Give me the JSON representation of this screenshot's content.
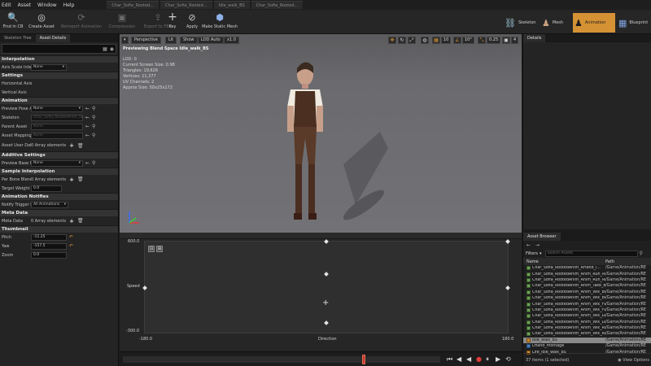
{
  "menubar": {
    "menus": [
      "Edit",
      "Asset",
      "Window",
      "Help"
    ],
    "tabs": [
      "Char_Sofia_Rooted...",
      "Char_Sofia_Rooted...",
      "Idle_walk_BS",
      "Char_Sofia_Rooted..."
    ]
  },
  "toolbar": {
    "find_in_cb": "Find in CB",
    "create_asset": "Create Asset",
    "reimport_animation": "Reimport Animation",
    "compression": "Compression",
    "export_to_fbx": "Export to FBX",
    "key": "Key",
    "apply": "Apply",
    "make_static_mesh": "Make Static Mesh"
  },
  "modes": {
    "skeleton": "Skeleton",
    "mesh": "Mesh",
    "animation": "Animation",
    "blueprint": "Blueprint"
  },
  "left_panel": {
    "tabs": [
      "Skeleton Tree",
      "Asset Details"
    ],
    "sections": {
      "interpolation": "Interpolation",
      "settings": "Settings",
      "animation": "Animation",
      "additive": "Additive Settings",
      "sample_interp": "Sample Interpolation",
      "notifies": "Animation Notifies",
      "meta": "Meta Data",
      "thumbnail": "Thumbnail"
    },
    "rows": {
      "scale_axis_label": "Axis Scale Interpol",
      "scale_axis_value": "None",
      "horizontal_axis": "Horizontal Axis",
      "vertical_axis": "Vertical Axis",
      "preview_pose_label": "Preview Pose Asset",
      "preview_pose_value": "None",
      "skeleton_label": "Skeleton",
      "skeleton_value": "Char_Sofia_RootedAnim_Sk...",
      "parent_asset_label": "Parent Asset",
      "parent_asset_value": "None",
      "asset_mapping_label": "Asset Mapping Table",
      "asset_mapping_value": "None",
      "asset_user_data_label": "Asset User Data",
      "asset_user_data_value": "0 Array elements",
      "preview_base_pose_label": "Preview Base Pose",
      "preview_base_pose_value": "None",
      "per_bone_blend_label": "Per Bone Blend",
      "per_bone_blend_value": "0 Array elements",
      "target_weight_label": "Target Weight Interp",
      "target_weight_value": "0.0",
      "notify_trigger_label": "Notify Trigger Mode",
      "notify_trigger_value": "All Animations",
      "meta_data_label": "Meta Data",
      "meta_data_value": "0 Array elements",
      "pitch_label": "Pitch",
      "pitch_value": "-11.25",
      "yaw_label": "Yaw",
      "yaw_value": "-157.5",
      "zoom_label": "Zoom",
      "zoom_value": "0.0"
    }
  },
  "viewport": {
    "perspective": "Perspective",
    "lit": "Lit",
    "show": "Show",
    "lod_auto": "LOD Auto",
    "speed": "x1.0",
    "title": "Previewing Blend Space Idle_walk_BS",
    "info_lines": [
      "LOD: 0",
      "Current Screen Size: 0.98",
      "Triangles: 19,626",
      "Vertices: 11,377",
      "UV Channels: 2",
      "Approx Size: 50x25x172"
    ],
    "grid_snap": "10",
    "rotation_snap": "10°",
    "scale_snap": "0.25",
    "camera_speed": "4"
  },
  "blendspace": {
    "y_label": "Speed",
    "y_max": "600.0",
    "y_min": "-300.0",
    "x_label": "Direction",
    "x_min": "-180.0",
    "x_max": "180.0"
  },
  "right_panel": {
    "details_tab": "Details",
    "asset_browser_tab": "Asset Browser",
    "filters_label": "Filters",
    "search_placeholder": "Search Assets",
    "col_name": "Name",
    "col_path": "Path",
    "status": "37 items (1 selected)",
    "view_options": "View Options",
    "assets": [
      {
        "name": "Char_Sofia_RootedAnim_RHand_l...",
        "path": "/Game/Animation/RE",
        "kind": "anim"
      },
      {
        "name": "Char_Sofia_RootedAnim_Anim_Run_Ri...",
        "path": "/Game/Animation/RE",
        "kind": "anim"
      },
      {
        "name": "Char_Sofia_RootedAnim_Anim_Run_Ri...",
        "path": "/Game/Animation/RE",
        "kind": "anim"
      },
      {
        "name": "Char_Sofia_RootedAnim_Anim_Take_B...",
        "path": "/Game/Animation/RE",
        "kind": "anim"
      },
      {
        "name": "Char_Sofia_RootedAnim_Anim_Wlk_Bc...",
        "path": "/Game/Animation/RE",
        "kind": "anim"
      },
      {
        "name": "Char_Sofia_RootedAnim_Anim_Wlk_Bc...",
        "path": "/Game/Animation/RE",
        "kind": "anim"
      },
      {
        "name": "Char_Sofia_RootedAnim_Anim_Wlk_Fw...",
        "path": "/Game/Animation/RE",
        "kind": "anim"
      },
      {
        "name": "Char_Sofia_RootedAnim_Anim_Wlk_Fw...",
        "path": "/Game/Animation/RE",
        "kind": "anim"
      },
      {
        "name": "Char_Sofia_RootedAnim_Anim_Wlk_Le...",
        "path": "/Game/Animation/RE",
        "kind": "anim"
      },
      {
        "name": "Char_Sofia_RootedAnim_Anim_Wlk_Le...",
        "path": "/Game/Animation/RE",
        "kind": "anim"
      },
      {
        "name": "Char_Sofia_RootedAnim_Anim_Wlk_Ri...",
        "path": "/Game/Animation/RE",
        "kind": "anim"
      },
      {
        "name": "Char_Sofia_RootedAnim_Anim_Wlk_Ri...",
        "path": "/Game/Animation/RE",
        "kind": "anim"
      },
      {
        "name": "Idle_walk_BS",
        "path": "/Game/Animation/RE",
        "kind": "bs",
        "selected": true
      },
      {
        "name": "LHand_montage",
        "path": "/Game/Animation/RE",
        "kind": "mont"
      },
      {
        "name": "Life_idle_walk_BS",
        "path": "/Game/Animation/RE",
        "kind": "bs"
      }
    ]
  },
  "colors": {
    "accent": "#d59234",
    "panel_bg": "#242424",
    "viewport_bg": "#6b6b6f"
  }
}
